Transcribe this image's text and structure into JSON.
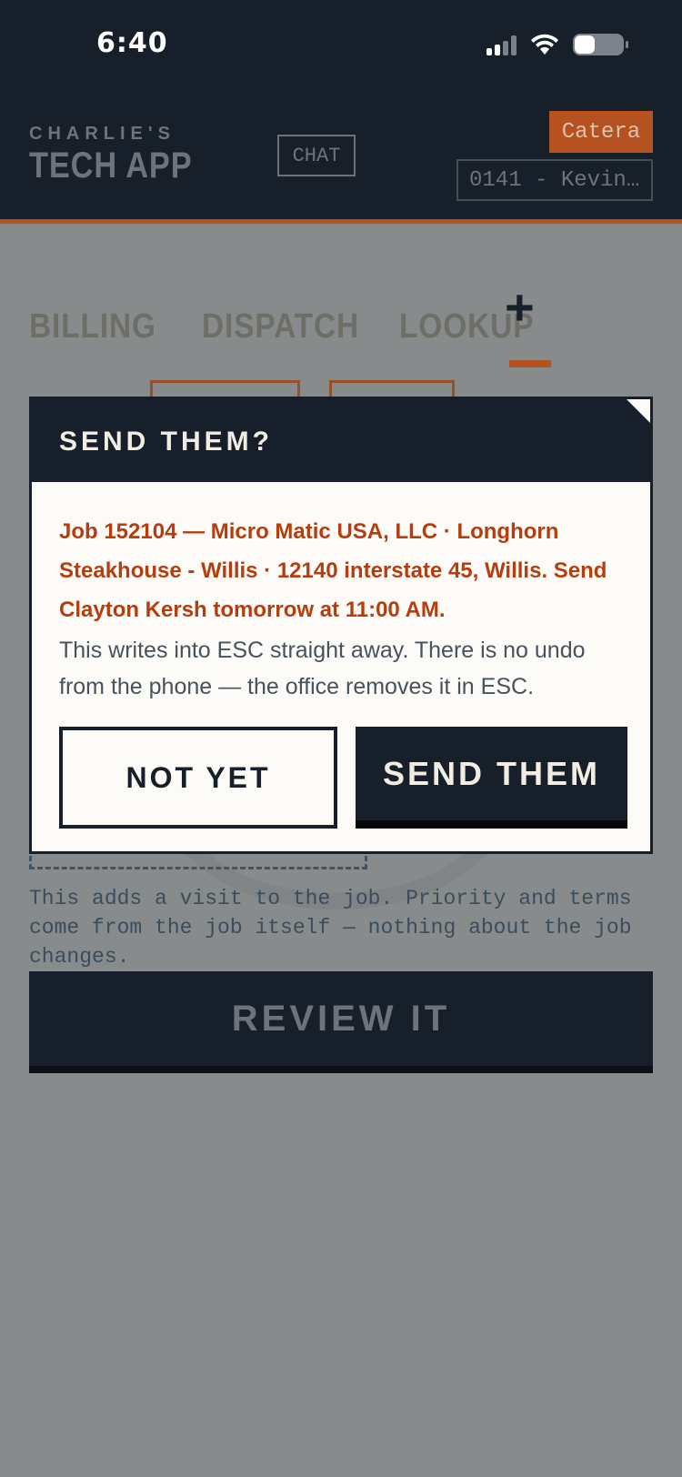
{
  "status_bar": {
    "time": "6:40"
  },
  "header": {
    "brand_small": "CHARLIE'S",
    "brand_big": "TECH APP",
    "chat_label": "CHAT",
    "tenant_badge": "Catera",
    "account_select": "0141 - Kevin…"
  },
  "tabs": [
    {
      "label": "BILLING"
    },
    {
      "label": "DISPATCH"
    },
    {
      "label": "LOOKUP"
    },
    {
      "label": "+"
    }
  ],
  "form": {
    "help_text": "This adds a visit to the job. Priority and terms come from the job itself — nothing about the job changes.",
    "review_button": "REVIEW IT"
  },
  "modal": {
    "title": "SEND THEM?",
    "summary": "Job 152104 — Micro Matic USA, LLC · Longhorn Steakhouse - Willis · 12140 interstate 45, Willis. Send Clayton Kersh tomorrow at 11:00 AM.",
    "body": "This writes into ESC straight away. There is no undo from the phone — the office removes it in ESC.",
    "cancel_label": "NOT YET",
    "confirm_label": "SEND THEM"
  },
  "colors": {
    "navy": "#17202a",
    "accent": "#b5521f",
    "summary_text": "#b53d0e",
    "overlay": "#878b8c"
  },
  "icons": [
    "signal-icon",
    "wifi-icon",
    "battery-icon",
    "plus-icon"
  ]
}
